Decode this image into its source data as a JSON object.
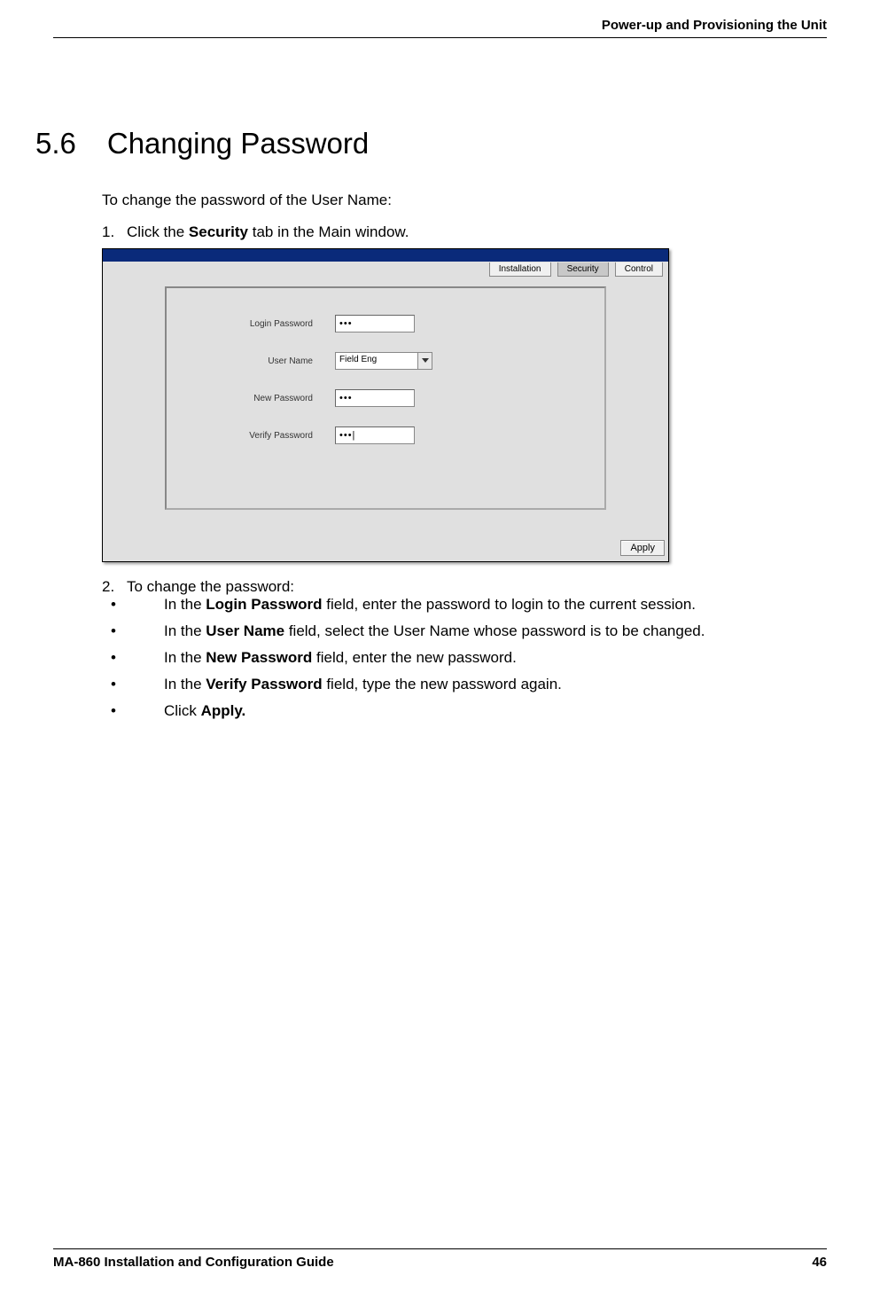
{
  "header": {
    "text": "Power-up and Provisioning the Unit"
  },
  "section": {
    "number": "5.6",
    "title": "Changing Password"
  },
  "intro": "To change the password of the User Name:",
  "step1": {
    "num": "1.",
    "pre": "Click the ",
    "bold": "Security",
    "post": " tab in the Main window."
  },
  "screenshot": {
    "tabs": {
      "installation": "Installation",
      "security": "Security",
      "control": "Control"
    },
    "form": {
      "login_password": {
        "label": "Login Password",
        "value": "•••"
      },
      "user_name": {
        "label": "User Name",
        "value": "Field Eng"
      },
      "new_password": {
        "label": "New Password",
        "value": "•••"
      },
      "verify_password": {
        "label": "Verify Password",
        "value": "•••|"
      }
    },
    "apply": "Apply"
  },
  "step2": {
    "num": "2.",
    "text": "To change the password:",
    "bullets": {
      "a": {
        "pre": "In the ",
        "bold": "Login Password",
        "post": " field, enter the password to login to the current session."
      },
      "b": {
        "pre": "In the ",
        "bold": "User Name",
        "post": " field, select the User Name whose password is to be changed."
      },
      "c": {
        "pre": "In the ",
        "bold": "New Password",
        "post": " field, enter the new password."
      },
      "d": {
        "pre": "In the ",
        "bold": "Verify Password",
        "post": " field, type the new password again."
      },
      "e": {
        "pre": "Click ",
        "bold": "Apply.",
        "post": ""
      }
    }
  },
  "footer": {
    "title": "MA-860 Installation and Configuration Guide",
    "page": "46"
  }
}
